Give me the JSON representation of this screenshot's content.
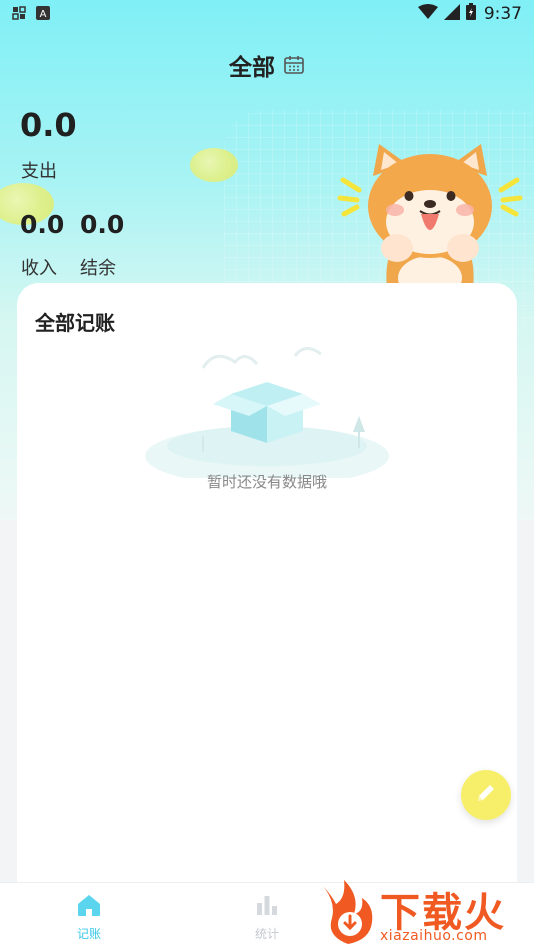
{
  "status_bar": {
    "time": "9:37"
  },
  "header": {
    "title": "全部"
  },
  "summary": {
    "expense_value": "0.0",
    "expense_label": "支出",
    "income_value": "0.0",
    "income_label": "收入",
    "balance_value": "0.0",
    "balance_label": "结余"
  },
  "card": {
    "title": "全部记账",
    "empty_text": "暂时还没有数据哦"
  },
  "tabs": [
    {
      "label": "记账",
      "icon": "home-icon",
      "active": true
    },
    {
      "label": "统计",
      "icon": "chart-icon",
      "active": false
    }
  ],
  "watermark": {
    "text": "下载火",
    "url": "xiazaihuo.com"
  },
  "colors": {
    "accent": "#39c8e6",
    "fab": "#f7ef6a",
    "hero_top": "#7ff0f6",
    "watermark": "#f05a22"
  }
}
